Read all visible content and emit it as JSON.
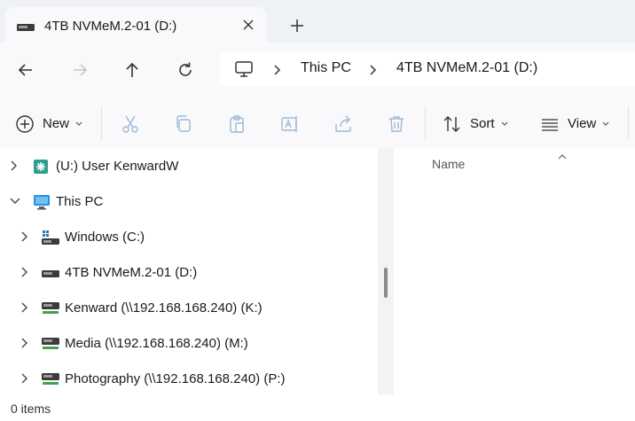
{
  "tab": {
    "title": "4TB NVMeM.2-01 (D:)"
  },
  "breadcrumb": [
    "This PC",
    "4TB NVMeM.2-01 (D:)"
  ],
  "toolbar": {
    "new_label": "New",
    "sort_label": "Sort",
    "view_label": "View"
  },
  "tree": [
    {
      "label": "(U:) User KenwardW",
      "icon": "network-folder-icon"
    },
    {
      "label": "This PC",
      "icon": "pc-icon"
    },
    {
      "label": "Windows (C:)",
      "icon": "windows-drive-icon"
    },
    {
      "label": "4TB NVMeM.2-01 (D:)",
      "icon": "drive-icon"
    },
    {
      "label": "Kenward (\\\\192.168.168.240) (K:)",
      "icon": "network-drive-icon"
    },
    {
      "label": "Media (\\\\192.168.168.240) (M:)",
      "icon": "network-drive-icon"
    },
    {
      "label": "Photography (\\\\192.168.168.240) (P:)",
      "icon": "network-drive-icon"
    }
  ],
  "content": {
    "column_name": "Name"
  },
  "status": {
    "item_count": "0 items"
  },
  "colors": {
    "tabstrip": "#eef1f5",
    "accent": "#2f6fb7",
    "network_green": "#3fa34d"
  }
}
